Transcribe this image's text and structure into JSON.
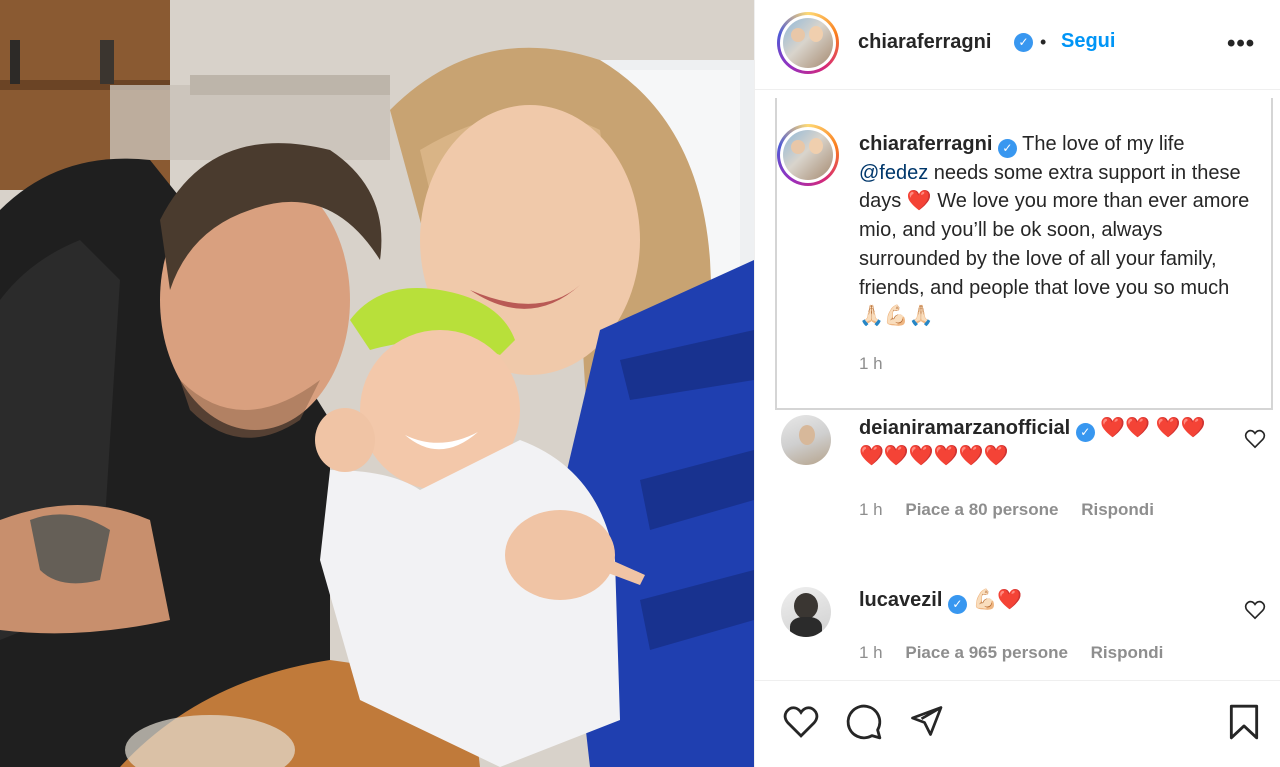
{
  "post": {
    "username": "chiaraferragni",
    "follow_label": "Segui",
    "separator": "•",
    "more_label": "•••"
  },
  "caption": {
    "username": "chiaraferragni",
    "part1": "The love of my life",
    "mention": "@fedez",
    "part2": "needs some extra support in these days",
    "heart": "❤️",
    "part3": "We love you more than ever amore mio, and you’ll be ok soon, always surrounded by the love of all your family, friends, and people that love you so much",
    "emojis": "🙏🏻💪🏻🙏🏻",
    "time": "1 h"
  },
  "comments": [
    {
      "username": "deianiramarzanofficial",
      "text": "❤️❤️ ❤️❤️❤️❤️❤️❤️❤️❤️",
      "time": "1 h",
      "likes": "Piace a 80 persone",
      "reply": "Rispondi"
    },
    {
      "username": "lucavezil",
      "text": "💪🏻❤️",
      "time": "1 h",
      "likes": "Piace a 965 persone",
      "reply": "Rispondi"
    }
  ],
  "icons": {
    "verified": "✓",
    "like": "heart-icon",
    "comment": "comment-icon",
    "share": "share-icon",
    "save": "bookmark-icon"
  },
  "colors": {
    "accent": "#0095f6",
    "verified": "#3897f0",
    "heart": "#e0245e"
  }
}
